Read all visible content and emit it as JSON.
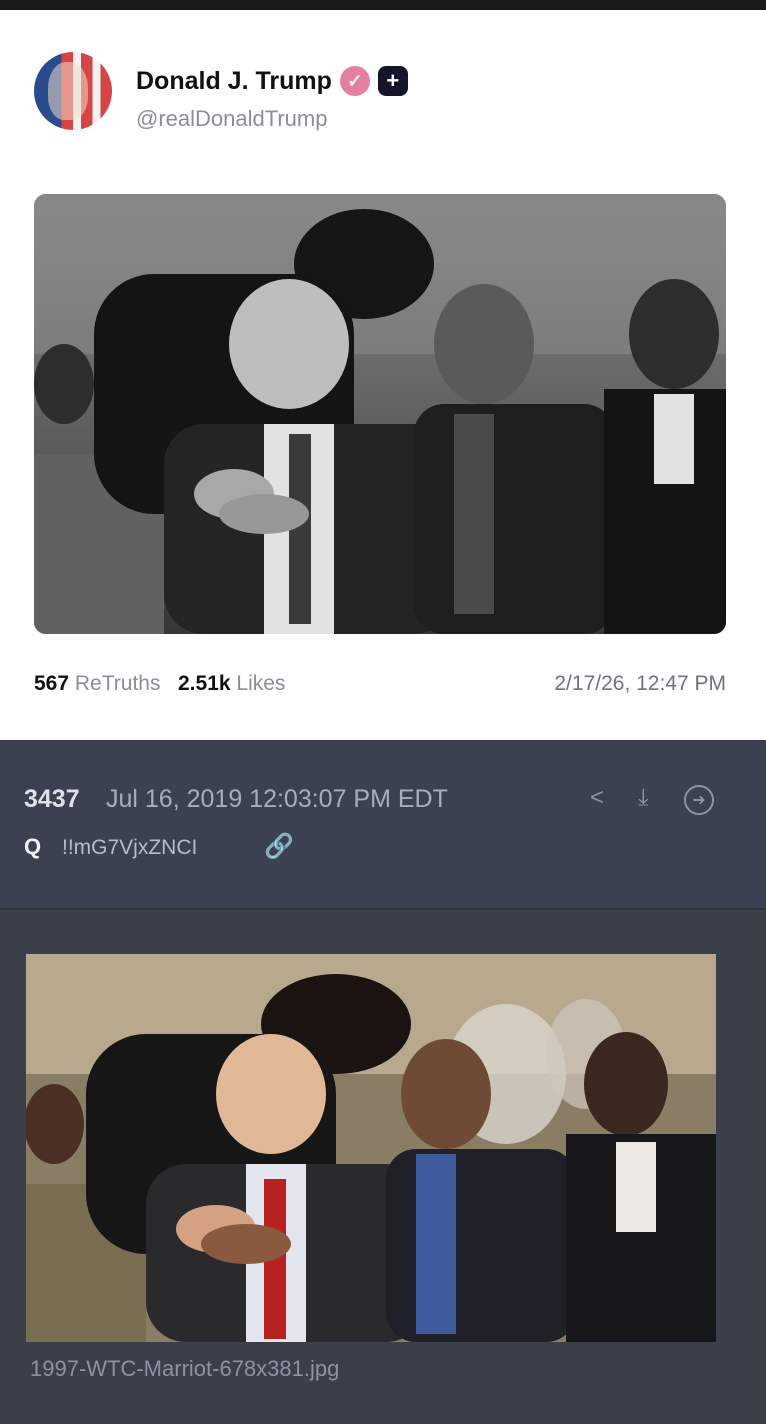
{
  "post": {
    "display_name": "Donald J. Trump",
    "handle": "@realDonaldTrump",
    "verified_icon": "verified-check-icon",
    "plus_icon": "plus-badge-icon",
    "retruths_count": "567",
    "retruths_label": "ReTruths",
    "likes_count": "2.51k",
    "likes_label": "Likes",
    "timestamp": "2/17/26, 12:47 PM"
  },
  "qpost": {
    "number": "3437",
    "date": "Jul 16, 2019 12:03:07 PM EDT",
    "author": "Q",
    "tripcode": "!!mG7VjxZNCI",
    "icons": [
      "link-icon",
      "share-icon",
      "download-icon",
      "arrow-circle-icon"
    ],
    "filename": "1997-WTC-Marriot-678x381.jpg"
  },
  "colors": {
    "card_bg": "#ffffff",
    "board_bg": "#3a3f4a",
    "verified": "#e57fa0",
    "link": "#5a8ee8"
  }
}
